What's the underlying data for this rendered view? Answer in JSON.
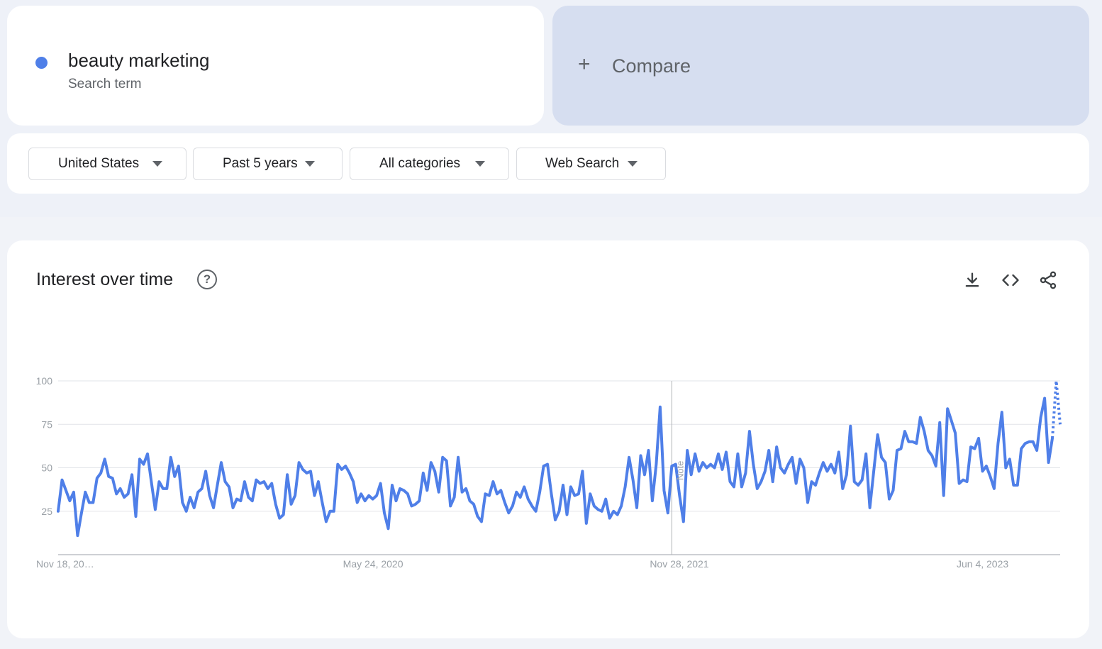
{
  "search_term": {
    "name": "beauty marketing",
    "type_label": "Search term",
    "color": "#4f7fe8"
  },
  "compare": {
    "icon": "plus-icon",
    "label": "Compare"
  },
  "filters": [
    {
      "label": "United States",
      "icon": "caret-down-icon"
    },
    {
      "label": "Past 5 years",
      "icon": "caret-down-icon"
    },
    {
      "label": "All categories",
      "icon": "caret-down-icon"
    },
    {
      "label": "Web Search",
      "icon": "caret-down-icon"
    }
  ],
  "chart_panel": {
    "title": "Interest over time",
    "help_icon": "help-icon",
    "toolbar": [
      "download-icon",
      "embed-code-icon",
      "share-icon"
    ]
  },
  "chart_data": {
    "type": "line",
    "ylim": [
      0,
      100
    ],
    "y_ticks": [
      "100",
      "75",
      "50",
      "25"
    ],
    "x_ticks": [
      "Nov 18, 20…",
      "May 24, 2020",
      "Nov 28, 2021",
      "Jun 4, 2023"
    ],
    "x_tick_index": [
      0,
      79,
      158,
      237
    ],
    "annotation": {
      "label": "Note",
      "index": 158
    },
    "partial_last_points": 2,
    "grid": true,
    "color": "#4f7fe8",
    "series": [
      {
        "values": [
          25,
          43,
          37,
          31,
          36,
          11,
          24,
          36,
          30,
          30,
          44,
          47,
          55,
          45,
          44,
          35,
          38,
          33,
          35,
          46,
          22,
          55,
          52,
          58,
          42,
          26,
          42,
          38,
          38,
          56,
          45,
          51,
          30,
          25,
          33,
          27,
          36,
          38,
          48,
          34,
          27,
          40,
          53,
          42,
          39,
          27,
          32,
          31,
          42,
          33,
          31,
          43,
          41,
          42,
          38,
          41,
          29,
          21,
          23,
          46,
          29,
          34,
          53,
          49,
          47,
          48,
          34,
          42,
          30,
          19,
          25,
          25,
          52,
          49,
          51,
          47,
          42,
          30,
          35,
          31,
          34,
          32,
          34,
          41,
          24,
          15,
          40,
          31,
          38,
          37,
          35,
          28,
          29,
          31,
          47,
          37,
          53,
          48,
          36,
          56,
          54,
          28,
          33,
          56,
          36,
          38,
          31,
          29,
          22,
          19,
          35,
          34,
          42,
          35,
          37,
          30,
          24,
          28,
          36,
          33,
          39,
          32,
          28,
          25,
          36,
          51,
          52,
          35,
          20,
          25,
          40,
          23,
          39,
          34,
          35,
          48,
          18,
          35,
          28,
          26,
          25,
          32,
          21,
          25,
          23,
          28,
          39,
          56,
          43,
          27,
          57,
          46,
          60,
          31,
          52,
          85,
          37,
          24,
          51,
          52,
          34,
          19,
          60,
          46,
          58,
          48,
          53,
          50,
          52,
          50,
          58,
          49,
          59,
          42,
          39,
          58,
          39,
          47,
          71,
          52,
          38,
          42,
          48,
          60,
          42,
          62,
          50,
          47,
          52,
          56,
          41,
          55,
          50,
          30,
          42,
          40,
          47,
          53,
          48,
          52,
          47,
          59,
          38,
          46,
          74,
          42,
          40,
          43,
          58,
          27,
          48,
          69,
          56,
          53,
          32,
          37,
          60,
          61,
          71,
          65,
          65,
          64,
          79,
          71,
          60,
          57,
          51,
          76,
          34,
          84,
          77,
          70,
          41,
          43,
          42,
          62,
          61,
          67,
          48,
          51,
          45,
          38,
          64,
          82,
          50,
          55,
          40,
          40,
          61,
          64,
          65,
          65,
          60,
          79,
          90,
          53,
          67,
          100,
          75
        ]
      }
    ]
  }
}
